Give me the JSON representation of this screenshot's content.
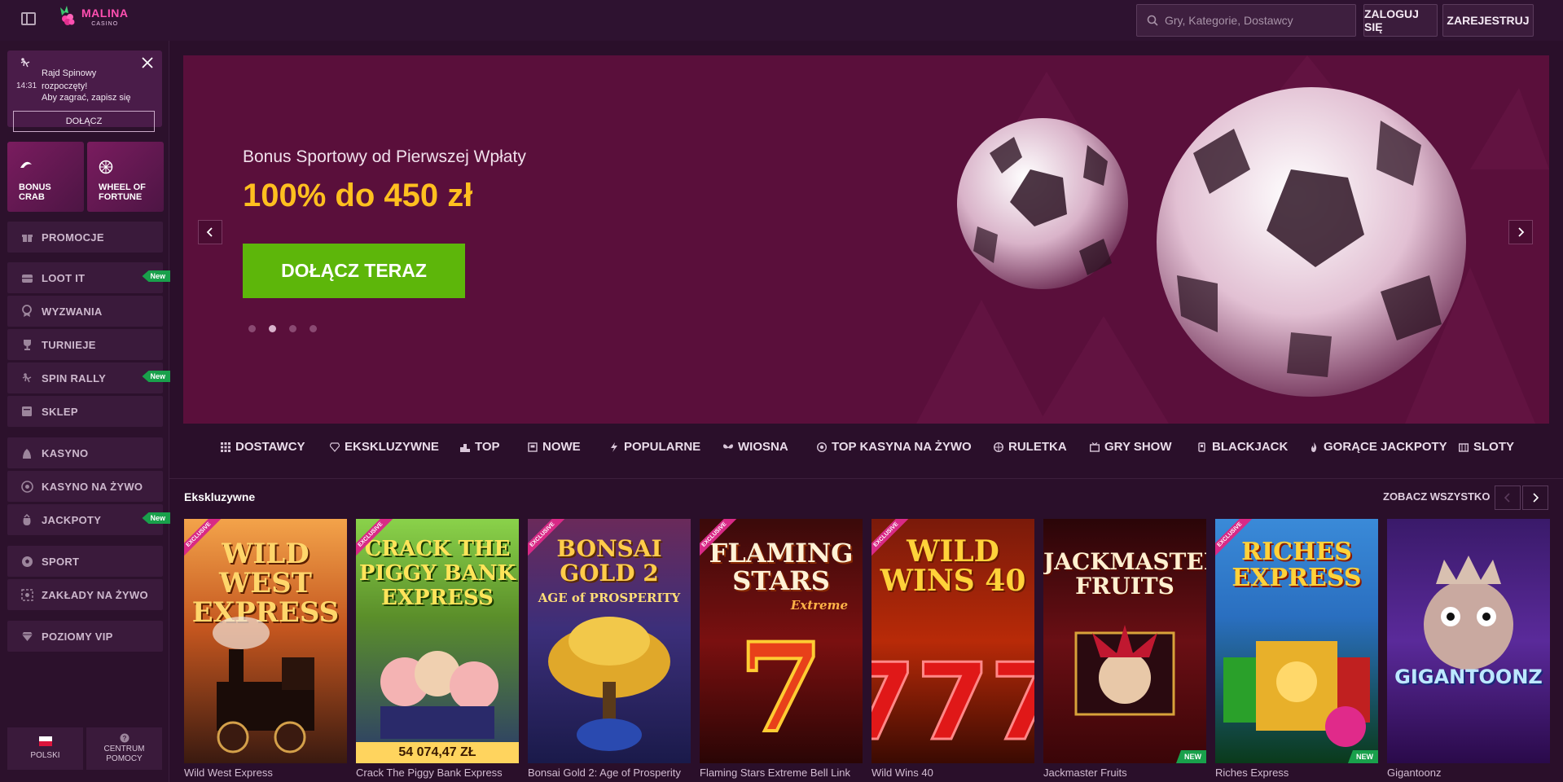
{
  "header": {
    "logo_text": "MALINA",
    "logo_sub": "CASINO",
    "search_placeholder": "Gry, Kategorie, Dostawcy",
    "login_label": "ZALOGUJ SIĘ",
    "register_label": "ZAREJESTRUJ"
  },
  "notification": {
    "time": "14:31",
    "line1": "Rajd Spinowy rozpoczęty!",
    "line2": "Aby zagrać, zapisz się",
    "join_label": "DOŁĄCZ"
  },
  "tiles": [
    {
      "label1": "BONUS",
      "label2": "CRAB"
    },
    {
      "label1": "WHEEL OF",
      "label2": "FORTUNE"
    }
  ],
  "sidebar": {
    "items": [
      {
        "label": "PROMOCJE",
        "icon": "gift-icon"
      },
      {
        "label": "LOOT IT",
        "icon": "chest-icon",
        "badge": "New"
      },
      {
        "label": "WYZWANIA",
        "icon": "medal-icon"
      },
      {
        "label": "TURNIEJE",
        "icon": "trophy-icon"
      },
      {
        "label": "SPIN RALLY",
        "icon": "spin-icon",
        "badge": "New"
      },
      {
        "label": "SKLEP",
        "icon": "shop-icon"
      },
      {
        "label": "KASYNO",
        "icon": "casino-icon"
      },
      {
        "label": "KASYNO NA ŻYWO",
        "icon": "live-casino-icon"
      },
      {
        "label": "JACKPOTY",
        "icon": "jackpot-icon",
        "badge": "New"
      },
      {
        "label": "SPORT",
        "icon": "ball-icon"
      },
      {
        "label": "ZAKŁADY NA ŻYWO",
        "icon": "live-bet-icon"
      },
      {
        "label": "POZIOMY VIP",
        "icon": "diamond-icon"
      }
    ],
    "language_label": "POLSKI",
    "help_label1": "CENTRUM",
    "help_label2": "POMOCY"
  },
  "banner": {
    "subtitle": "Bonus Sportowy od Pierwszej Wpłaty",
    "title": "100% do 450 zł",
    "cta_label": "DOŁĄCZ TERAZ",
    "active_slide": 2,
    "slide_count": 4
  },
  "categories": [
    {
      "label": "DOSTAWCY",
      "icon": "grid-icon"
    },
    {
      "label": "EKSKLUZYWNE",
      "icon": "diamond-icon"
    },
    {
      "label": "TOP",
      "icon": "podium-icon"
    },
    {
      "label": "NOWE",
      "icon": "new-icon"
    },
    {
      "label": "POPULARNE",
      "icon": "bolt-icon"
    },
    {
      "label": "WIOSNA",
      "icon": "butterfly-icon"
    },
    {
      "label": "TOP KASYNA NA ŻYWO",
      "icon": "chip-icon"
    },
    {
      "label": "RULETKA",
      "icon": "roulette-icon"
    },
    {
      "label": "GRY SHOW",
      "icon": "show-icon"
    },
    {
      "label": "BLACKJACK",
      "icon": "cards-icon"
    },
    {
      "label": "GORĄCE JACKPOTY",
      "icon": "flame-icon"
    },
    {
      "label": "SLOTY",
      "icon": "slot-icon"
    }
  ],
  "section": {
    "title": "Ekskluzywne",
    "see_all_label": "ZOBACZ WSZYSTKO"
  },
  "games": [
    {
      "name": "Wild West Express",
      "art_title": "WILD WEST EXPRESS",
      "exclusive": "EXCLUSIVE",
      "bg": "#c4561f"
    },
    {
      "name": "Crack The Piggy Bank Express",
      "art_title": "CRACK THE PIGGY BANK EXPRESS",
      "exclusive": "EXCLUSIVE",
      "jackpot": "54 074,47 ZŁ",
      "bg": "#5b8f2a"
    },
    {
      "name": "Bonsai Gold 2: Age of Prosperity",
      "art_title": "BONSAI GOLD 2",
      "art_sub": "AGE of PROSPERITY",
      "exclusive": "EXCLUSIVE",
      "bg": "#3c2f7a"
    },
    {
      "name": "Flaming Stars Extreme Bell Link",
      "art_title": "FLAMING STARS",
      "art_sub": "Extreme",
      "exclusive": "EXCLUSIVE",
      "bg": "#7a1010"
    },
    {
      "name": "Wild Wins 40",
      "art_title": "WILD WINS 40",
      "exclusive": "EXCLUSIVE",
      "bg": "#b82a08"
    },
    {
      "name": "Jackmaster Fruits",
      "art_title": "JACKMASTER FRUITS",
      "new": "NEW",
      "bg": "#6a0f14"
    },
    {
      "name": "Riches Express",
      "art_title": "RICHES EXPRESS",
      "exclusive": "EXCLUSIVE",
      "new": "NEW",
      "bg": "#2a6fc0"
    },
    {
      "name": "Gigantoonz",
      "art_title": "GIGANTOONZ",
      "bg": "#5a2a9a"
    }
  ]
}
